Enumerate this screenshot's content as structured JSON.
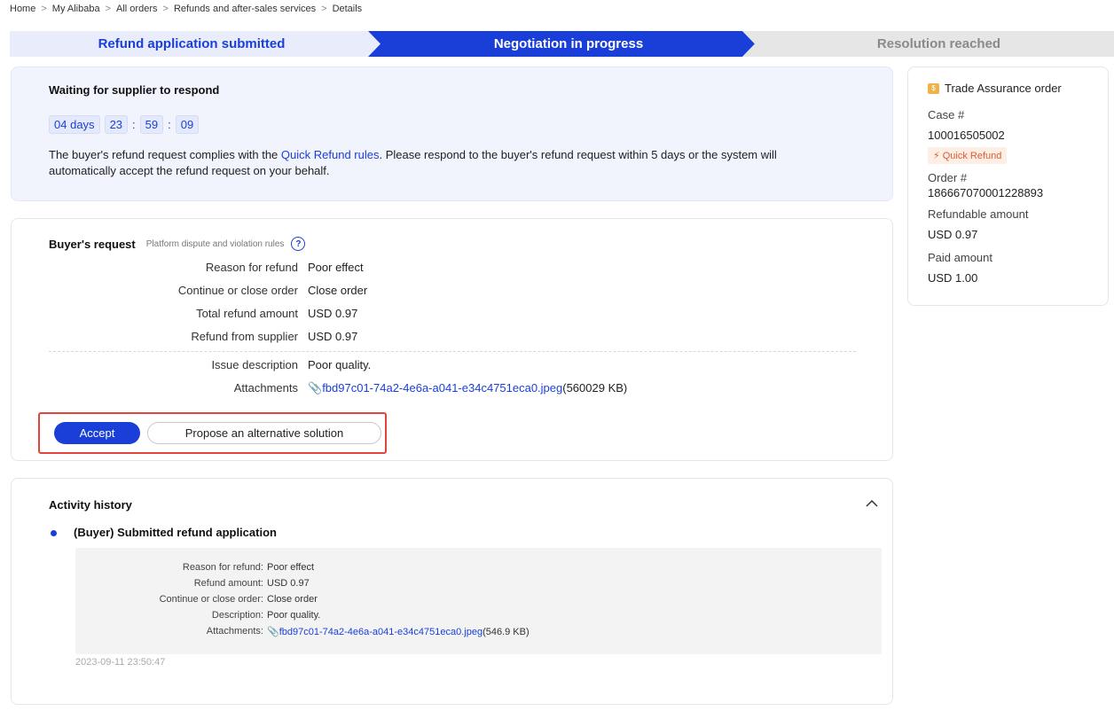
{
  "breadcrumb": {
    "items": [
      "Home",
      "My Alibaba",
      "All orders",
      "Refunds and after-sales services",
      "Details"
    ],
    "separator": ">"
  },
  "steps": {
    "items": [
      {
        "label": "Refund application submitted",
        "state": "done"
      },
      {
        "label": "Negotiation in progress",
        "state": "active"
      },
      {
        "label": "Resolution reached",
        "state": "pending"
      }
    ],
    "colors": {
      "done": "#e8ecfb",
      "active": "#1a3fd8",
      "pending": "#e6e6e6"
    }
  },
  "waiting": {
    "title": "Waiting for supplier to respond",
    "countdown": {
      "days": "04",
      "days_label": "days",
      "hours": "23",
      "minutes": "59",
      "seconds": "09",
      "sep": ":"
    },
    "desc_before": "The buyer's refund request complies with the ",
    "desc_link": "Quick Refund rules",
    "desc_after": ". Please respond to the buyer's refund request within 5 days or the system will automatically accept the refund request on your behalf."
  },
  "buyer_request": {
    "title": "Buyer's request",
    "rules_label": "Platform dispute and violation rules",
    "help_icon": "?",
    "rows": [
      {
        "label": "Reason for refund",
        "value": "Poor effect"
      },
      {
        "label": "Continue or close order",
        "value": "Close order"
      },
      {
        "label": "Total refund amount",
        "value": "USD 0.97"
      },
      {
        "label": "Refund from supplier",
        "value": "USD 0.97"
      }
    ],
    "issue": {
      "label": "Issue description",
      "value": "Poor quality."
    },
    "attachments": {
      "label": "Attachments",
      "file": "fbd97c01-74a2-4e6a-a041-e34c4751eca0.jpeg",
      "size": "(560029 KB)"
    },
    "accept_label": "Accept",
    "alternative_label": "Propose an alternative solution"
  },
  "history": {
    "title": "Activity history",
    "event_title": "(Buyer) Submitted refund application",
    "rows": [
      {
        "label": "Reason for refund:",
        "value": "Poor effect"
      },
      {
        "label": "Refund amount:",
        "value": "USD 0.97"
      },
      {
        "label": "Continue or close order:",
        "value": "Close order"
      },
      {
        "label": "Description:",
        "value": "Poor quality."
      }
    ],
    "attachments": {
      "label": "Attachments:",
      "file": "fbd97c01-74a2-4e6a-a041-e34c4751eca0.jpeg",
      "size": "(546.9 KB)"
    },
    "timestamp": "2023-09-11 23:50:47"
  },
  "side": {
    "title": "Trade Assurance order",
    "case_label": "Case #",
    "case_value": "100016505002",
    "badge": "Quick Refund",
    "order_label": "Order #",
    "order_value": "186667070001228893",
    "refundable_label": "Refundable amount",
    "refundable_value": "USD 0.97",
    "paid_label": "Paid amount",
    "paid_value": "USD 1.00"
  }
}
